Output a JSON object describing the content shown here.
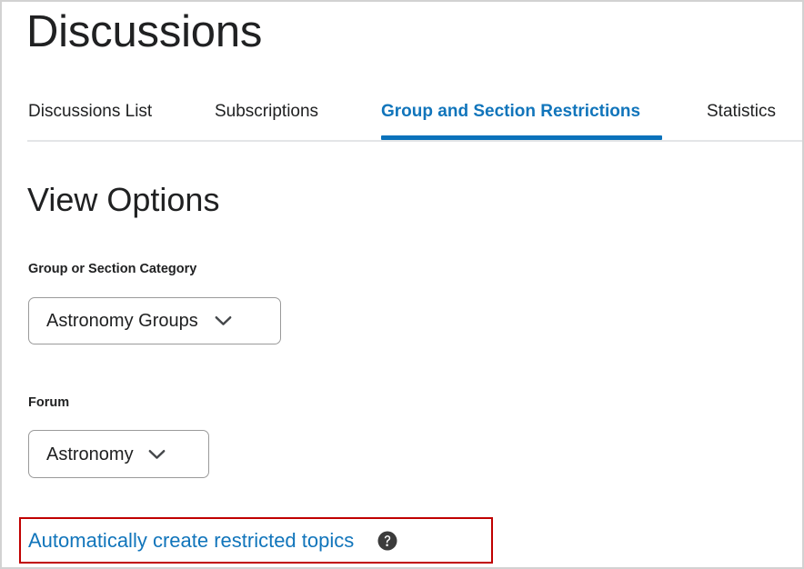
{
  "page": {
    "title": "Discussions",
    "border_color": "#d2d2d2"
  },
  "tabs": {
    "items": [
      {
        "label": "Discussions List",
        "active": false
      },
      {
        "label": "Subscriptions",
        "active": false
      },
      {
        "label": "Group and Section Restrictions",
        "active": true
      },
      {
        "label": "Statistics",
        "active": false
      }
    ],
    "active_color": "#1175bb",
    "underline_color": "#0a72bb",
    "divider_color": "#e3e5e7"
  },
  "view_options": {
    "heading": "View Options",
    "fields": [
      {
        "label": "Group or Section Category",
        "value": "Astronomy Groups",
        "chevron_icon": "chevron-down-icon"
      },
      {
        "label": "Forum",
        "value": "Astronomy",
        "chevron_icon": "chevron-down-icon"
      }
    ]
  },
  "auto_create": {
    "link_label": "Automatically create restricted topics",
    "link_color": "#1175bb",
    "help_icon": "help-circle-icon",
    "help_icon_color": "#3b3b3b",
    "annotation_color": "#c00000"
  }
}
